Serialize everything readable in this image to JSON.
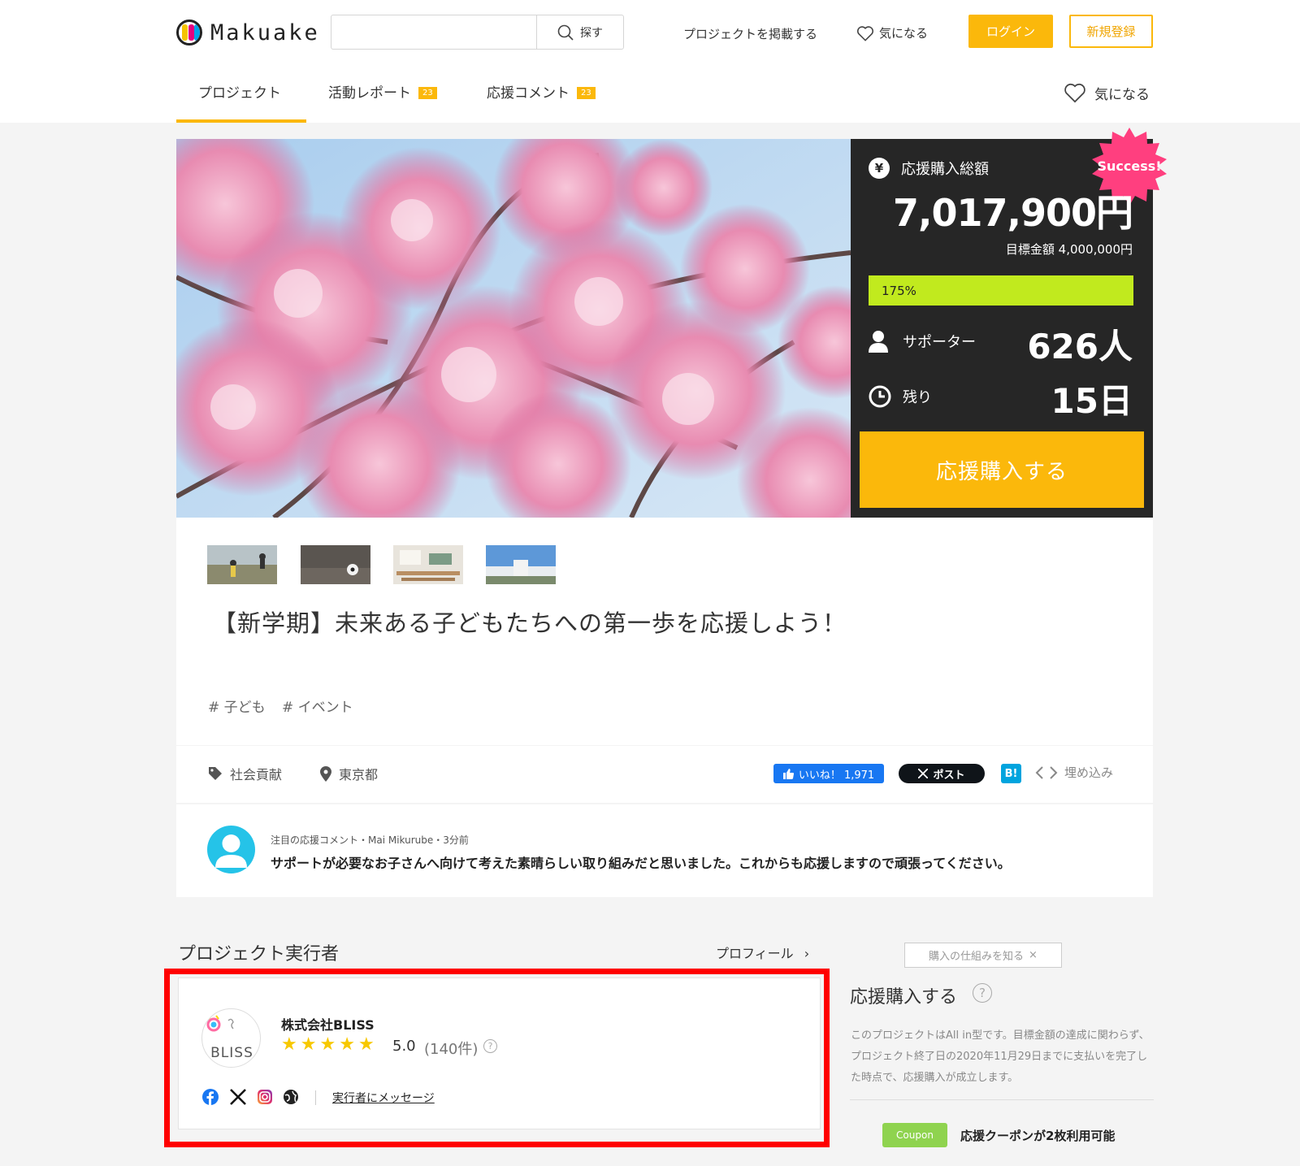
{
  "header": {
    "logo_text": "Makuake",
    "search_placeholder": "",
    "search_button": "探す",
    "post_project": "プロジェクトを掲載する",
    "favorite": "気になる",
    "login": "ログイン",
    "signup": "新規登録"
  },
  "tabs": [
    {
      "label": "プロジェクト",
      "badge": ""
    },
    {
      "label": "活動レポート",
      "badge": "23"
    },
    {
      "label": "応援コメント",
      "badge": "23"
    }
  ],
  "tab_favorite": "気になる",
  "funding": {
    "label": "応援購入総額",
    "yen_symbol": "¥",
    "amount": "7,017,900円",
    "goal": "目標金額 4,000,000円",
    "percent_label": "175%",
    "percent": 175,
    "supporters_label": "サポーター",
    "supporters": "626人",
    "remaining_label": "残り",
    "remaining": "15日",
    "success_badge": "Success!",
    "buy_button": "応援購入する"
  },
  "project": {
    "title": "【新学期】未来ある子どもたちへの第一歩を応援しよう！",
    "tags": [
      "# 子ども",
      "# イベント"
    ],
    "category": "社会貢献",
    "location": "東京都"
  },
  "share": {
    "fb": "いいね！ 1,971",
    "x": "ポスト",
    "hatena": "B!",
    "embed": "埋め込み"
  },
  "comment": {
    "meta": "注目の応援コメント・Mai Mikurube・3分前",
    "text": "サポートが必要なお子さんへ向けて考えた素晴らしい取り組みだと思いました。これからも応援しますので頑張ってください。"
  },
  "owner": {
    "section_title": "プロジェクト実行者",
    "profile_link": "プロフィール",
    "logo_text": "BLISS",
    "name": "株式会社BLISS",
    "rating": "5.0",
    "rating_count": "(140件)",
    "stars": 5,
    "message_link": "実行者にメッセージ"
  },
  "purchase": {
    "tooltip": "購入の仕組みを知る",
    "tooltip_close": "×",
    "title": "応援購入する",
    "description": "このプロジェクトはAll in型です。目標金額の達成に関わらず、プロジェクト終了日の2020年11月29日までに支払いを完了した時点で、応援購入が成立します。",
    "coupon_badge": "Coupon",
    "coupon_text": "応援クーポンが2枚利用可能"
  },
  "colors": {
    "accent": "#fbb80b",
    "progress": "#c1ea1e",
    "panel": "#262626",
    "success": "#ff3f7f",
    "highlight": "#ff0000"
  }
}
